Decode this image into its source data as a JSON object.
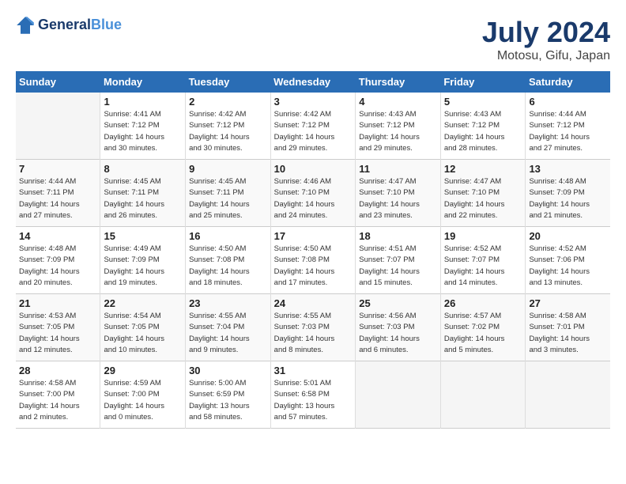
{
  "header": {
    "logo_line1": "General",
    "logo_line2": "Blue",
    "month": "July 2024",
    "location": "Motosu, Gifu, Japan"
  },
  "days_of_week": [
    "Sunday",
    "Monday",
    "Tuesday",
    "Wednesday",
    "Thursday",
    "Friday",
    "Saturday"
  ],
  "weeks": [
    [
      {
        "num": "",
        "info": ""
      },
      {
        "num": "1",
        "info": "Sunrise: 4:41 AM\nSunset: 7:12 PM\nDaylight: 14 hours\nand 30 minutes."
      },
      {
        "num": "2",
        "info": "Sunrise: 4:42 AM\nSunset: 7:12 PM\nDaylight: 14 hours\nand 30 minutes."
      },
      {
        "num": "3",
        "info": "Sunrise: 4:42 AM\nSunset: 7:12 PM\nDaylight: 14 hours\nand 29 minutes."
      },
      {
        "num": "4",
        "info": "Sunrise: 4:43 AM\nSunset: 7:12 PM\nDaylight: 14 hours\nand 29 minutes."
      },
      {
        "num": "5",
        "info": "Sunrise: 4:43 AM\nSunset: 7:12 PM\nDaylight: 14 hours\nand 28 minutes."
      },
      {
        "num": "6",
        "info": "Sunrise: 4:44 AM\nSunset: 7:12 PM\nDaylight: 14 hours\nand 27 minutes."
      }
    ],
    [
      {
        "num": "7",
        "info": "Sunrise: 4:44 AM\nSunset: 7:11 PM\nDaylight: 14 hours\nand 27 minutes."
      },
      {
        "num": "8",
        "info": "Sunrise: 4:45 AM\nSunset: 7:11 PM\nDaylight: 14 hours\nand 26 minutes."
      },
      {
        "num": "9",
        "info": "Sunrise: 4:45 AM\nSunset: 7:11 PM\nDaylight: 14 hours\nand 25 minutes."
      },
      {
        "num": "10",
        "info": "Sunrise: 4:46 AM\nSunset: 7:10 PM\nDaylight: 14 hours\nand 24 minutes."
      },
      {
        "num": "11",
        "info": "Sunrise: 4:47 AM\nSunset: 7:10 PM\nDaylight: 14 hours\nand 23 minutes."
      },
      {
        "num": "12",
        "info": "Sunrise: 4:47 AM\nSunset: 7:10 PM\nDaylight: 14 hours\nand 22 minutes."
      },
      {
        "num": "13",
        "info": "Sunrise: 4:48 AM\nSunset: 7:09 PM\nDaylight: 14 hours\nand 21 minutes."
      }
    ],
    [
      {
        "num": "14",
        "info": "Sunrise: 4:48 AM\nSunset: 7:09 PM\nDaylight: 14 hours\nand 20 minutes."
      },
      {
        "num": "15",
        "info": "Sunrise: 4:49 AM\nSunset: 7:09 PM\nDaylight: 14 hours\nand 19 minutes."
      },
      {
        "num": "16",
        "info": "Sunrise: 4:50 AM\nSunset: 7:08 PM\nDaylight: 14 hours\nand 18 minutes."
      },
      {
        "num": "17",
        "info": "Sunrise: 4:50 AM\nSunset: 7:08 PM\nDaylight: 14 hours\nand 17 minutes."
      },
      {
        "num": "18",
        "info": "Sunrise: 4:51 AM\nSunset: 7:07 PM\nDaylight: 14 hours\nand 15 minutes."
      },
      {
        "num": "19",
        "info": "Sunrise: 4:52 AM\nSunset: 7:07 PM\nDaylight: 14 hours\nand 14 minutes."
      },
      {
        "num": "20",
        "info": "Sunrise: 4:52 AM\nSunset: 7:06 PM\nDaylight: 14 hours\nand 13 minutes."
      }
    ],
    [
      {
        "num": "21",
        "info": "Sunrise: 4:53 AM\nSunset: 7:05 PM\nDaylight: 14 hours\nand 12 minutes."
      },
      {
        "num": "22",
        "info": "Sunrise: 4:54 AM\nSunset: 7:05 PM\nDaylight: 14 hours\nand 10 minutes."
      },
      {
        "num": "23",
        "info": "Sunrise: 4:55 AM\nSunset: 7:04 PM\nDaylight: 14 hours\nand 9 minutes."
      },
      {
        "num": "24",
        "info": "Sunrise: 4:55 AM\nSunset: 7:03 PM\nDaylight: 14 hours\nand 8 minutes."
      },
      {
        "num": "25",
        "info": "Sunrise: 4:56 AM\nSunset: 7:03 PM\nDaylight: 14 hours\nand 6 minutes."
      },
      {
        "num": "26",
        "info": "Sunrise: 4:57 AM\nSunset: 7:02 PM\nDaylight: 14 hours\nand 5 minutes."
      },
      {
        "num": "27",
        "info": "Sunrise: 4:58 AM\nSunset: 7:01 PM\nDaylight: 14 hours\nand 3 minutes."
      }
    ],
    [
      {
        "num": "28",
        "info": "Sunrise: 4:58 AM\nSunset: 7:00 PM\nDaylight: 14 hours\nand 2 minutes."
      },
      {
        "num": "29",
        "info": "Sunrise: 4:59 AM\nSunset: 7:00 PM\nDaylight: 14 hours\nand 0 minutes."
      },
      {
        "num": "30",
        "info": "Sunrise: 5:00 AM\nSunset: 6:59 PM\nDaylight: 13 hours\nand 58 minutes."
      },
      {
        "num": "31",
        "info": "Sunrise: 5:01 AM\nSunset: 6:58 PM\nDaylight: 13 hours\nand 57 minutes."
      },
      {
        "num": "",
        "info": ""
      },
      {
        "num": "",
        "info": ""
      },
      {
        "num": "",
        "info": ""
      }
    ]
  ]
}
